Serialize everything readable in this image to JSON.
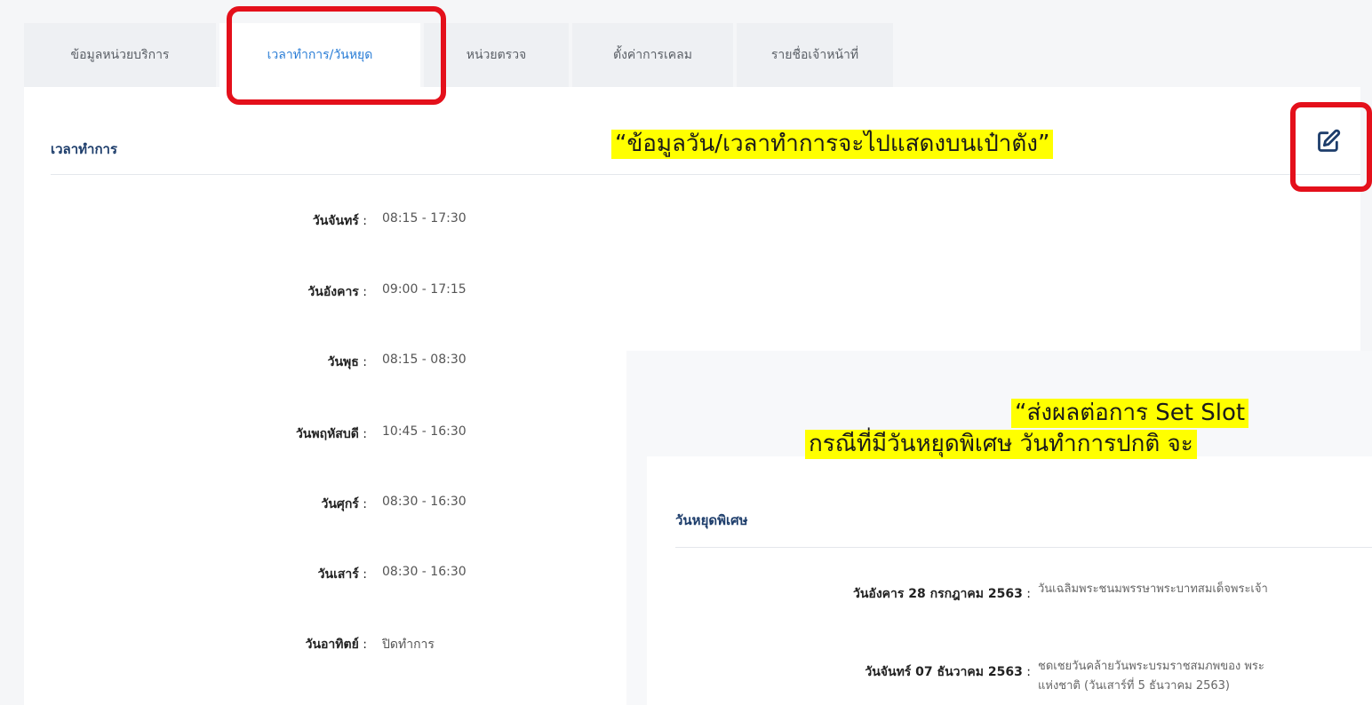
{
  "tabs": [
    {
      "label": "ข้อมูลหน่วยบริการ",
      "active": false
    },
    {
      "label": "เวลาทำการ/วันหยุด",
      "active": true
    },
    {
      "label": "หน่วยตรวจ",
      "active": false
    },
    {
      "label": "ตั้งค่าการเคลม",
      "active": false
    },
    {
      "label": "รายชื่อเจ้าหน้าที่",
      "active": false
    }
  ],
  "working_hours": {
    "title": "เวลาทำการ",
    "rows": [
      {
        "day": "วันจันทร์",
        "time": "08:15 - 17:30"
      },
      {
        "day": "วันอังคาร",
        "time": "09:00 - 17:15"
      },
      {
        "day": "วันพุธ",
        "time": "08:15 - 08:30"
      },
      {
        "day": "วันพฤหัสบดี",
        "time": "10:45 - 16:30"
      },
      {
        "day": "วันศุกร์",
        "time": "08:30 - 16:30"
      },
      {
        "day": "วันเสาร์",
        "time": "08:30 - 16:30"
      },
      {
        "day": "วันอาทิตย์",
        "time": "ปิดทำการ"
      }
    ]
  },
  "special_holidays": {
    "title": "วันหยุดพิเศษ",
    "rows": [
      {
        "date": "วันอังคาร 28 กรกฎาคม 2563",
        "desc": [
          "วันเฉลิมพระชนมพรรษาพระบาทสมเด็จพระเจ้า"
        ]
      },
      {
        "date": "วันจันทร์ 07 ธันวาคม 2563",
        "desc": [
          "ชดเชยวันคล้ายวันพระบรมราชสมภพของ พระ",
          "แห่งชาติ (วันเสาร์ที่ 5 ธันวาคม 2563)"
        ]
      }
    ]
  },
  "annotations": {
    "note1": "“ข้อมูลวัน/เวลาทำการจะไปแสดงบนเป๋าตัง”",
    "note2": "“ส่งผลต่อการ Set Slot",
    "note3": "กรณีที่มีวันหยุดพิเศษ วันทำการปกติ จะ"
  },
  "colors": {
    "highlight": "#ffff00",
    "callout_border": "#e4101b",
    "active_tab_text": "#2a7dd6",
    "section_title": "#1d3d6b"
  },
  "icons": {
    "edit": "edit-icon"
  }
}
